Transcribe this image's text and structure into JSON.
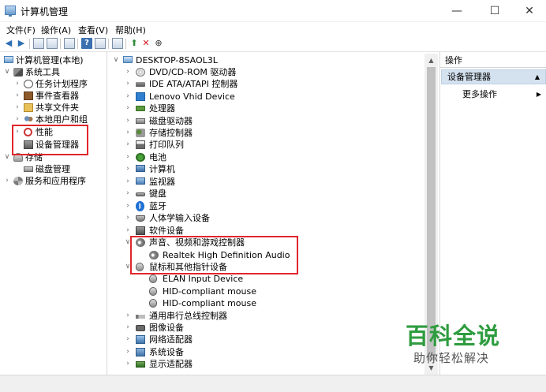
{
  "window": {
    "title": "计算机管理",
    "minimize": "—",
    "maximize": "☐",
    "close": "✕"
  },
  "menu": [
    "文件(F)",
    "操作(A)",
    "查看(V)",
    "帮助(H)"
  ],
  "left_tree": [
    {
      "label": "计算机管理(本地)",
      "expander": ""
    },
    {
      "label": "系统工具",
      "expander": "∨"
    },
    {
      "label": "任务计划程序",
      "expander": "›"
    },
    {
      "label": "事件查看器",
      "expander": "›"
    },
    {
      "label": "共享文件夹",
      "expander": "›"
    },
    {
      "label": "本地用户和组",
      "expander": "›"
    },
    {
      "label": "性能",
      "expander": "›"
    },
    {
      "label": "设备管理器",
      "expander": ""
    },
    {
      "label": "存储",
      "expander": "∨"
    },
    {
      "label": "磁盘管理",
      "expander": ""
    },
    {
      "label": "服务和应用程序",
      "expander": "›"
    }
  ],
  "device_tree": {
    "root": "DESKTOP-8SAOL3L",
    "root_expander": "∨",
    "items": [
      {
        "label": "DVD/CD-ROM 驱动器",
        "expander": "›"
      },
      {
        "label": "IDE ATA/ATAPI 控制器",
        "expander": "›"
      },
      {
        "label": "Lenovo Vhid Device",
        "expander": "›"
      },
      {
        "label": "处理器",
        "expander": "›"
      },
      {
        "label": "磁盘驱动器",
        "expander": "›"
      },
      {
        "label": "存储控制器",
        "expander": "›"
      },
      {
        "label": "打印队列",
        "expander": "›"
      },
      {
        "label": "电池",
        "expander": "›"
      },
      {
        "label": "计算机",
        "expander": "›"
      },
      {
        "label": "监视器",
        "expander": "›"
      },
      {
        "label": "键盘",
        "expander": "›"
      },
      {
        "label": "蓝牙",
        "expander": "›"
      },
      {
        "label": "人体学输入设备",
        "expander": "›"
      },
      {
        "label": "软件设备",
        "expander": "›"
      },
      {
        "label": "声音、视频和游戏控制器",
        "expander": "∨"
      },
      {
        "label": "Realtek High Definition Audio",
        "expander": ""
      },
      {
        "label": "鼠标和其他指针设备",
        "expander": "∨"
      },
      {
        "label": "ELAN Input Device",
        "expander": ""
      },
      {
        "label": "HID-compliant mouse",
        "expander": ""
      },
      {
        "label": "HID-compliant mouse",
        "expander": ""
      },
      {
        "label": "通用串行总线控制器",
        "expander": "›"
      },
      {
        "label": "图像设备",
        "expander": "›"
      },
      {
        "label": "网络适配器",
        "expander": "›"
      },
      {
        "label": "系统设备",
        "expander": "›"
      },
      {
        "label": "显示适配器",
        "expander": "›"
      }
    ]
  },
  "actions": {
    "header": "操作",
    "selected": "设备管理器",
    "selected_arrow": "▲",
    "more": "更多操作",
    "more_arrow": "▶"
  },
  "scrollbar": {
    "up": "▲",
    "down": "▼"
  },
  "watermark": {
    "title": "百科全说",
    "subtitle": "助你轻松解决"
  },
  "highlight_color": "#e0262b"
}
